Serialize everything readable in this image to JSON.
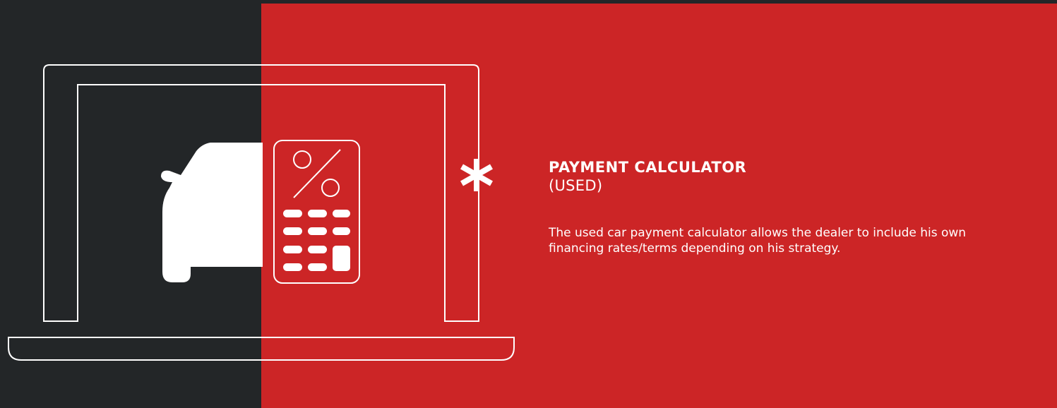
{
  "feature": {
    "title": "PAYMENT CALCULATOR",
    "subtitle": "(USED)",
    "description": "The used car payment calculator allows the dealer to include his own financing rates/terms depending on his strategy."
  },
  "icons": {
    "laptop": "laptop-icon",
    "car": "car-front-icon",
    "calculator": "calculator-percent-icon",
    "asterisk": "asterisk-icon"
  },
  "colors": {
    "background_dark": "#232628",
    "accent_red": "#cc2526",
    "line_white": "#ffffff"
  }
}
